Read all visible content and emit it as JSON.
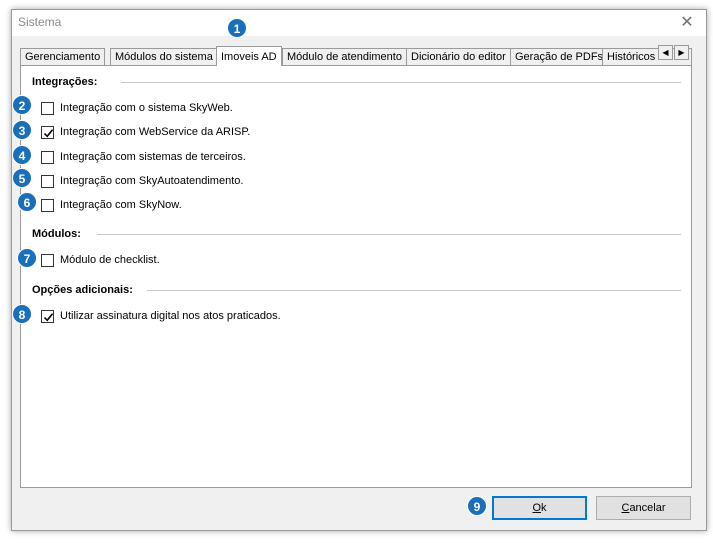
{
  "window": {
    "title": "Sistema"
  },
  "tabs": [
    "Gerenciamento",
    "Módulos do sistema",
    "Imoveis AD",
    "Módulo de atendimento",
    "Dicionário do editor",
    "Geração de PDFs",
    "Históricos c"
  ],
  "sections": {
    "integracoes": {
      "title": "Integrações:",
      "items": [
        {
          "label": "Integração com o sistema SkyWeb.",
          "checked": false
        },
        {
          "label": "Integração com WebService da ARISP.",
          "checked": true
        },
        {
          "label": "Integração com sistemas de terceiros.",
          "checked": false
        },
        {
          "label": "Integração com SkyAutoatendimento.",
          "checked": false
        },
        {
          "label": "Integração com SkyNow.",
          "checked": false
        }
      ]
    },
    "modulos": {
      "title": "Módulos:",
      "items": [
        {
          "label": "Módulo de checklist.",
          "checked": false
        }
      ]
    },
    "opcoes": {
      "title": "Opções adicionais:",
      "items": [
        {
          "label": "Utilizar assinatura digital nos atos praticados.",
          "checked": true
        }
      ]
    }
  },
  "buttons": {
    "ok_first": "O",
    "ok_rest": "k",
    "cancel_first": "C",
    "cancel_rest": "ancelar"
  },
  "badges": [
    "1",
    "2",
    "3",
    "4",
    "5",
    "6",
    "7",
    "8",
    "9"
  ],
  "colors": {
    "badge": "#1a6fba",
    "default_button_border": "#0078d7"
  },
  "icons": {
    "close": "close-icon",
    "scroll_left": "arrow-left-icon",
    "scroll_right": "arrow-right-icon",
    "check": "check-icon"
  }
}
